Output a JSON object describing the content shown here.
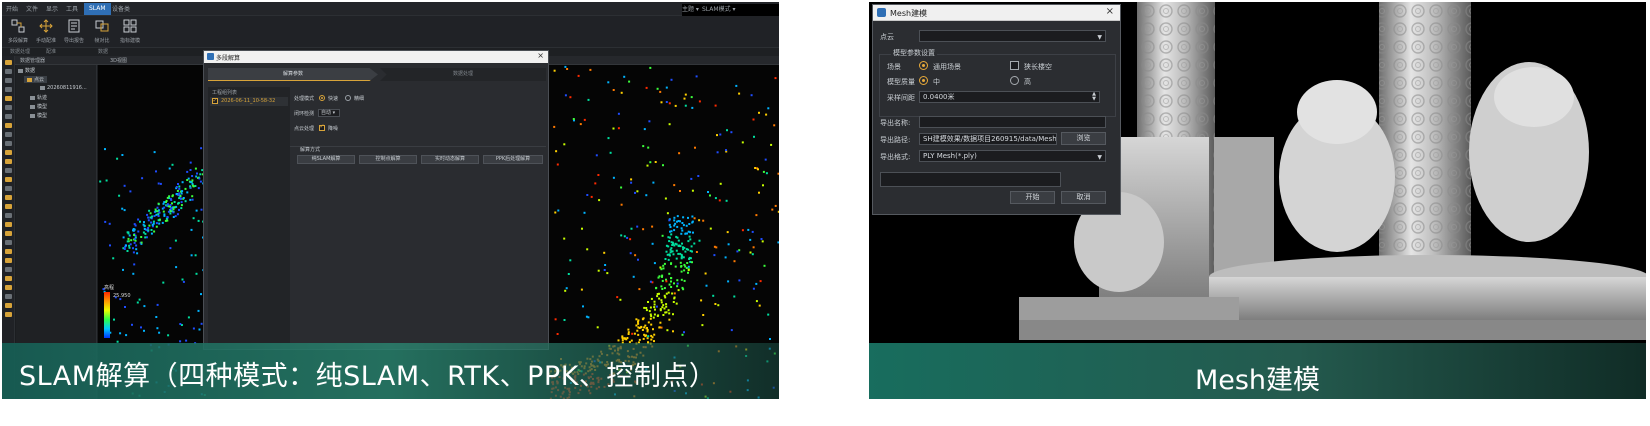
{
  "left": {
    "menu": [
      "开始",
      "文件",
      "显示",
      "工具",
      "SLAM",
      "设备类"
    ],
    "menu_right": [
      "主题 ▾",
      "SLAM模式 ▾"
    ],
    "tools": [
      "多段解算",
      "手动配准",
      "导出报告",
      "帧对比",
      "指标建模"
    ],
    "groups": [
      "数据处理",
      "配准",
      "数据"
    ],
    "tabs": [
      "数据管理器",
      "3D视图"
    ],
    "tree": [
      "数据",
      "点云",
      "20260811916...",
      "轨迹",
      "模型",
      "模型"
    ],
    "colorbar": {
      "title": "高程",
      "max": "25.950"
    },
    "dialog": {
      "title": "多段解算",
      "step1": "解算参数",
      "step2": "数据处理",
      "project_header": "工程组列表",
      "project_row": "2026-06-11_10-58-32",
      "mode_label": "处理模式",
      "mode_fast": "快速",
      "mode_fine": "精细",
      "loop_label": "闭环检测",
      "loop_value": "自动 ▾",
      "pc_label": "点云处理",
      "pc_value": "降噪",
      "section_title": "解算方式",
      "methods": [
        "纯SLAM解算",
        "控制点解算",
        "实时动态解算",
        "PPK后处理解算"
      ]
    },
    "caption": "SLAM解算（四种模式：纯SLAM、RTK、PPK、控制点）"
  },
  "right": {
    "dialog": {
      "title": "Mesh建模",
      "pointcloud_label": "点云",
      "pointcloud_value": "",
      "group_title": "模型参数设置",
      "scene_label": "场景",
      "scene_general": "通用场景",
      "scene_long": "狭长楼空",
      "quality_label": "模型质量",
      "quality_mid": "中",
      "quality_high": "高",
      "sample_label": "采样间距",
      "sample_value": "0.0400米",
      "export_name_label": "导出名称:",
      "export_name_value": "",
      "export_path_label": "导出路径:",
      "export_path_value": "SH建模效果/数据项目260915/data/Mesh/",
      "browse": "浏览",
      "format_label": "导出格式:",
      "format_value": "PLY Mesh(*.ply)",
      "start": "开始",
      "cancel": "取消"
    },
    "caption": "Mesh建模"
  }
}
